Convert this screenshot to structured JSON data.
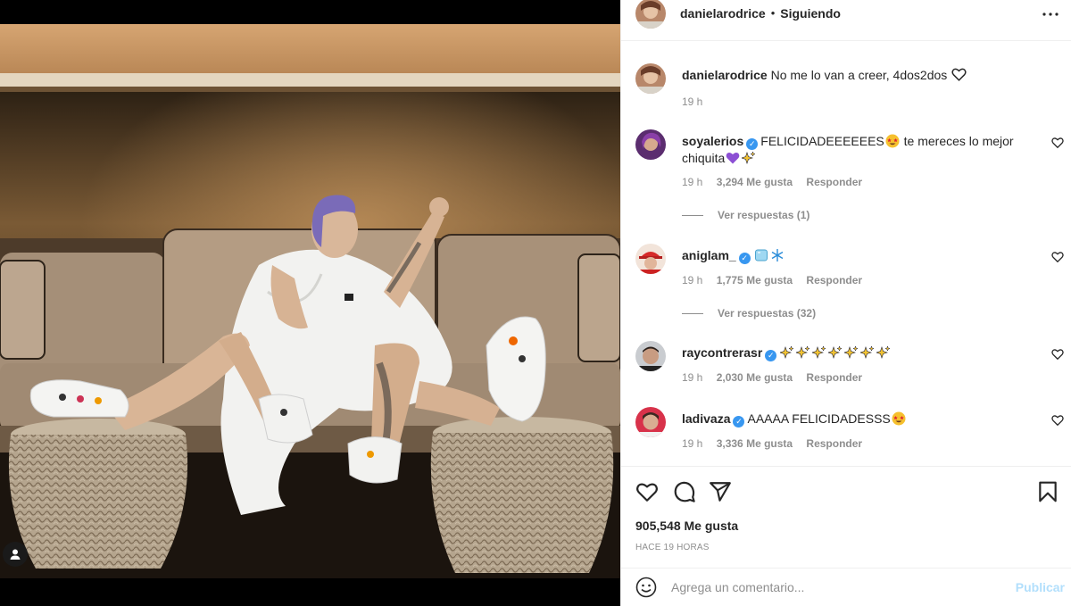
{
  "post": {
    "author": "danielarodrice",
    "follow_label": "Siguiendo",
    "dot": "•",
    "caption": {
      "username": "danielarodrice",
      "text": "No me lo van a creer, 4dos2dos",
      "time": "19 h"
    },
    "comments": [
      {
        "username": "soyalerios",
        "verified": true,
        "text_a": "FELICIDADEEEEEES",
        "text_b": " te mereces lo mejor chiquita",
        "time": "19 h",
        "likes": "3,294 Me gusta",
        "reply": "Responder",
        "view_replies": "Ver respuestas (1)"
      },
      {
        "username": "aniglam_",
        "verified": true,
        "text_a": "",
        "time": "19 h",
        "likes": "1,775 Me gusta",
        "reply": "Responder",
        "view_replies": "Ver respuestas (32)"
      },
      {
        "username": "raycontrerasr",
        "verified": true,
        "text_a": "",
        "time": "19 h",
        "likes": "2,030 Me gusta",
        "reply": "Responder"
      },
      {
        "username": "ladivaza",
        "verified": true,
        "text_a": "AAAAA FELICIDADESSS",
        "time": "19 h",
        "likes": "3,336 Me gusta",
        "reply": "Responder"
      }
    ],
    "likes_total": "905,548 Me gusta",
    "posted_ago": "HACE 19 HORAS",
    "comment_placeholder": "Agrega un comentario...",
    "publish_label": "Publicar"
  },
  "icons": {
    "heart": "heart-icon",
    "comment": "comment-icon",
    "share": "share-icon",
    "save": "bookmark-icon",
    "more": "more-options-icon",
    "smile": "emoji-icon",
    "tag": "user-tag-icon"
  },
  "colors": {
    "verified": "#3897f0",
    "publish_disabled": "#b2dffc",
    "muted": "#8e8e8e"
  }
}
